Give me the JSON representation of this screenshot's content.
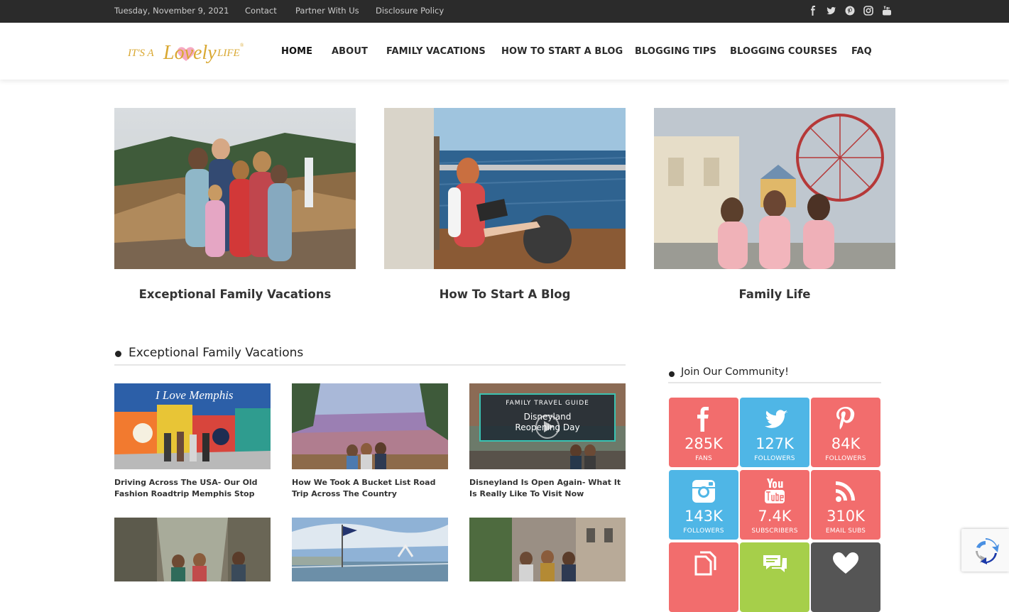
{
  "topbar": {
    "date": "Tuesday, November 9, 2021",
    "links": [
      "Contact",
      "Partner With Us",
      "Disclosure Policy"
    ],
    "social_icons": [
      "facebook-icon",
      "twitter-icon",
      "pinterest-icon",
      "instagram-icon",
      "youtube-icon"
    ]
  },
  "header": {
    "logo_text": "It's A Lovely Life",
    "nav": [
      "HOME",
      "ABOUT",
      "FAMILY VACATIONS",
      "HOW TO START A BLOG",
      "BLOGGING TIPS",
      "BLOGGING COURSES",
      "FAQ"
    ]
  },
  "features": [
    {
      "caption": "Exceptional Family Vacations"
    },
    {
      "caption": "How To Start A Blog"
    },
    {
      "caption": "Family Life"
    }
  ],
  "section": {
    "title": "Exceptional Family Vacations",
    "posts": [
      {
        "title": "Driving Across The USA- Our Old Fashion Roadtrip Memphis Stop",
        "thumb_text": "I Love Memphis"
      },
      {
        "title": "How We Took A Bucket List Road Trip Across The Country"
      },
      {
        "title": "Disneyland Is Open Again- What It Is Really Like To Visit Now",
        "thumb_text_1": "FAMILY TRAVEL GUIDE",
        "thumb_text_2": "Disneyland",
        "thumb_text_3": "Reopening Day"
      },
      {
        "title": ""
      },
      {
        "title": ""
      },
      {
        "title": ""
      }
    ]
  },
  "sidebar": {
    "title": "Join Our Community!",
    "tiles": [
      {
        "icon": "facebook-icon",
        "value": "285K",
        "label": "FANS",
        "color": "#f26d6d"
      },
      {
        "icon": "twitter-icon",
        "value": "127K",
        "label": "FOLLOWERS",
        "color": "#4fb6e6"
      },
      {
        "icon": "pinterest-icon",
        "value": "84K",
        "label": "FOLLOWERS",
        "color": "#f26d6d"
      },
      {
        "icon": "instagram-icon",
        "value": "143K",
        "label": "FOLLOWERS",
        "color": "#4fb6e6"
      },
      {
        "icon": "youtube-icon",
        "value": "7.4K",
        "label": "SUBSCRIBERS",
        "color": "#f26d6d"
      },
      {
        "icon": "rss-icon",
        "value": "310K",
        "label": "EMAIL SUBS",
        "color": "#f26d6d"
      },
      {
        "icon": "copy-icon",
        "value": "",
        "label": "",
        "color": "#f26d6d"
      },
      {
        "icon": "comments-icon",
        "value": "",
        "label": "",
        "color": "#a6cf4a"
      },
      {
        "icon": "heart-icon",
        "value": "",
        "label": "",
        "color": "#555555"
      }
    ]
  },
  "recaptcha": {
    "icon": "recaptcha-icon"
  }
}
